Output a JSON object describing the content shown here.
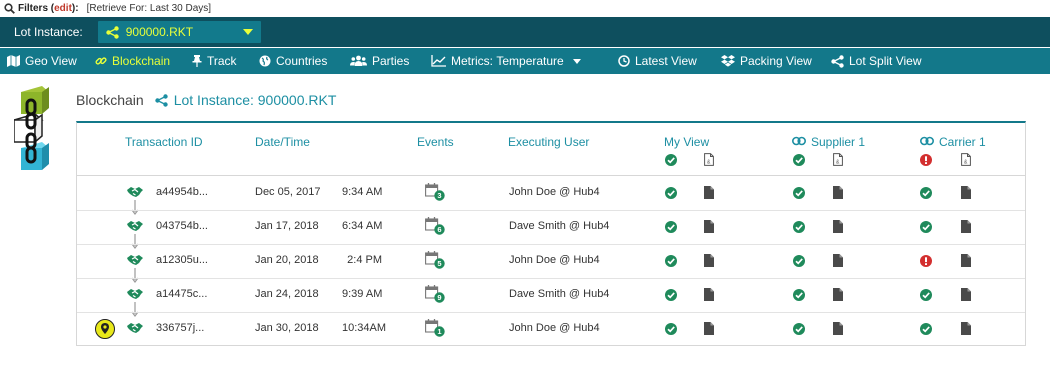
{
  "filters": {
    "label": "Filters",
    "edit": "edit",
    "retrieve": "[Retrieve For: Last 30 Days]"
  },
  "lot_instance": {
    "label": "Lot Instance:",
    "value": "900000.RKT"
  },
  "nav": {
    "geo_view": "Geo View",
    "blockchain": "Blockchain",
    "track": "Track",
    "countries": "Countries",
    "parties": "Parties",
    "metrics": "Metrics:",
    "metrics_value": "Temperature",
    "latest_view": "Latest View",
    "packing_view": "Packing View",
    "lot_split_view": "Lot Split View"
  },
  "page": {
    "title": "Blockchain",
    "lot_link": "Lot Instance: 900000.RKT"
  },
  "table": {
    "headers": {
      "transaction_id": "Transaction ID",
      "date_time": "Date/Time",
      "events": "Events",
      "executing_user": "Executing User",
      "my_view": "My View",
      "supplier": "Supplier 1",
      "carrier": "Carrier 1"
    },
    "header_status": {
      "my_view": "ok",
      "supplier": "ok",
      "carrier": "error"
    },
    "rows": [
      {
        "tx": "a44954b...",
        "date": "Dec 05, 2017",
        "time": "9:34 AM",
        "events": "3",
        "user": "John Doe @ Hub4",
        "my_view": "ok",
        "supplier": "ok",
        "carrier": "ok"
      },
      {
        "tx": "043754b...",
        "date": "Jan 17, 2018",
        "time": "6:34 AM",
        "events": "6",
        "user": "Dave Smith @ Hub4",
        "my_view": "ok",
        "supplier": "ok",
        "carrier": "ok"
      },
      {
        "tx": "a12305u...",
        "date": "Jan 20, 2018",
        "time": "2:4 PM",
        "events": "5",
        "user": "John Doe @ Hub4",
        "my_view": "ok",
        "supplier": "ok",
        "carrier": "error"
      },
      {
        "tx": "a14475c...",
        "date": "Jan 24, 2018",
        "time": "9:39 AM",
        "events": "9",
        "user": "Dave Smith @ Hub4",
        "my_view": "ok",
        "supplier": "ok",
        "carrier": "ok"
      },
      {
        "tx": "336757j...",
        "date": "Jan 30, 2018",
        "time": "10:34AM",
        "events": "1",
        "user": "John Doe @ Hub4",
        "my_view": "ok",
        "supplier": "ok",
        "carrier": "ok"
      }
    ]
  },
  "colors": {
    "ok": "#1f8a5b",
    "error": "#d32f2f",
    "accent": "#1d8fa3",
    "nav": "#13788a",
    "lot_bar": "#0e4f5e",
    "highlight": "#e8ff3a"
  },
  "icons": {
    "filter": "magnifier-icon",
    "share": "share-icon",
    "marker": "location-marker-icon"
  }
}
